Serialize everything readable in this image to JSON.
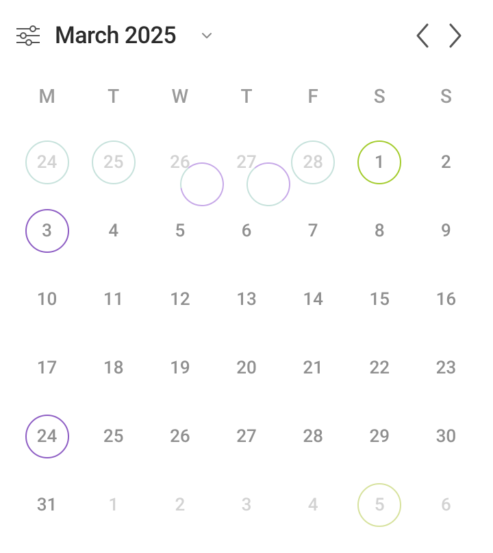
{
  "header": {
    "title": "March 2025"
  },
  "colors": {
    "teal": "#c7e2dc",
    "purple": "#8e5ec4",
    "purple_light": "#c7a9e8",
    "green": "#a4cc2e",
    "green_light": "#d7e29e",
    "text_current": "#8f8f8f",
    "text_other": "#d2d2d2"
  },
  "weekdays": [
    "M",
    "T",
    "W",
    "T",
    "F",
    "S",
    "S"
  ],
  "days": [
    {
      "n": 24,
      "m": "prev",
      "ring": {
        "type": "full",
        "color": "teal"
      }
    },
    {
      "n": 25,
      "m": "prev",
      "ring": {
        "type": "full",
        "color": "teal"
      }
    },
    {
      "n": 26,
      "m": "prev",
      "ring": {
        "type": "arc",
        "start": -40,
        "sweep": 300,
        "color": "purple_light",
        "base": "teal"
      }
    },
    {
      "n": 27,
      "m": "prev",
      "ring": {
        "type": "arc",
        "start": -40,
        "sweep": 180,
        "color": "purple_light",
        "base": "teal"
      }
    },
    {
      "n": 28,
      "m": "prev",
      "ring": {
        "type": "full",
        "color": "teal"
      }
    },
    {
      "n": 1,
      "m": "cur",
      "ring": {
        "type": "full",
        "color": "green"
      }
    },
    {
      "n": 2,
      "m": "cur"
    },
    {
      "n": 3,
      "m": "cur",
      "ring": {
        "type": "full",
        "color": "purple"
      }
    },
    {
      "n": 4,
      "m": "cur"
    },
    {
      "n": 5,
      "m": "cur"
    },
    {
      "n": 6,
      "m": "cur"
    },
    {
      "n": 7,
      "m": "cur"
    },
    {
      "n": 8,
      "m": "cur"
    },
    {
      "n": 9,
      "m": "cur"
    },
    {
      "n": 10,
      "m": "cur"
    },
    {
      "n": 11,
      "m": "cur"
    },
    {
      "n": 12,
      "m": "cur"
    },
    {
      "n": 13,
      "m": "cur"
    },
    {
      "n": 14,
      "m": "cur"
    },
    {
      "n": 15,
      "m": "cur"
    },
    {
      "n": 16,
      "m": "cur"
    },
    {
      "n": 17,
      "m": "cur"
    },
    {
      "n": 18,
      "m": "cur"
    },
    {
      "n": 19,
      "m": "cur"
    },
    {
      "n": 20,
      "m": "cur"
    },
    {
      "n": 21,
      "m": "cur"
    },
    {
      "n": 22,
      "m": "cur"
    },
    {
      "n": 23,
      "m": "cur"
    },
    {
      "n": 24,
      "m": "cur",
      "ring": {
        "type": "full",
        "color": "purple"
      }
    },
    {
      "n": 25,
      "m": "cur"
    },
    {
      "n": 26,
      "m": "cur"
    },
    {
      "n": 27,
      "m": "cur"
    },
    {
      "n": 28,
      "m": "cur"
    },
    {
      "n": 29,
      "m": "cur"
    },
    {
      "n": 30,
      "m": "cur"
    },
    {
      "n": 31,
      "m": "cur"
    },
    {
      "n": 1,
      "m": "next"
    },
    {
      "n": 2,
      "m": "next"
    },
    {
      "n": 3,
      "m": "next"
    },
    {
      "n": 4,
      "m": "next"
    },
    {
      "n": 5,
      "m": "next",
      "ring": {
        "type": "full",
        "color": "green_light"
      }
    },
    {
      "n": 6,
      "m": "next"
    }
  ]
}
